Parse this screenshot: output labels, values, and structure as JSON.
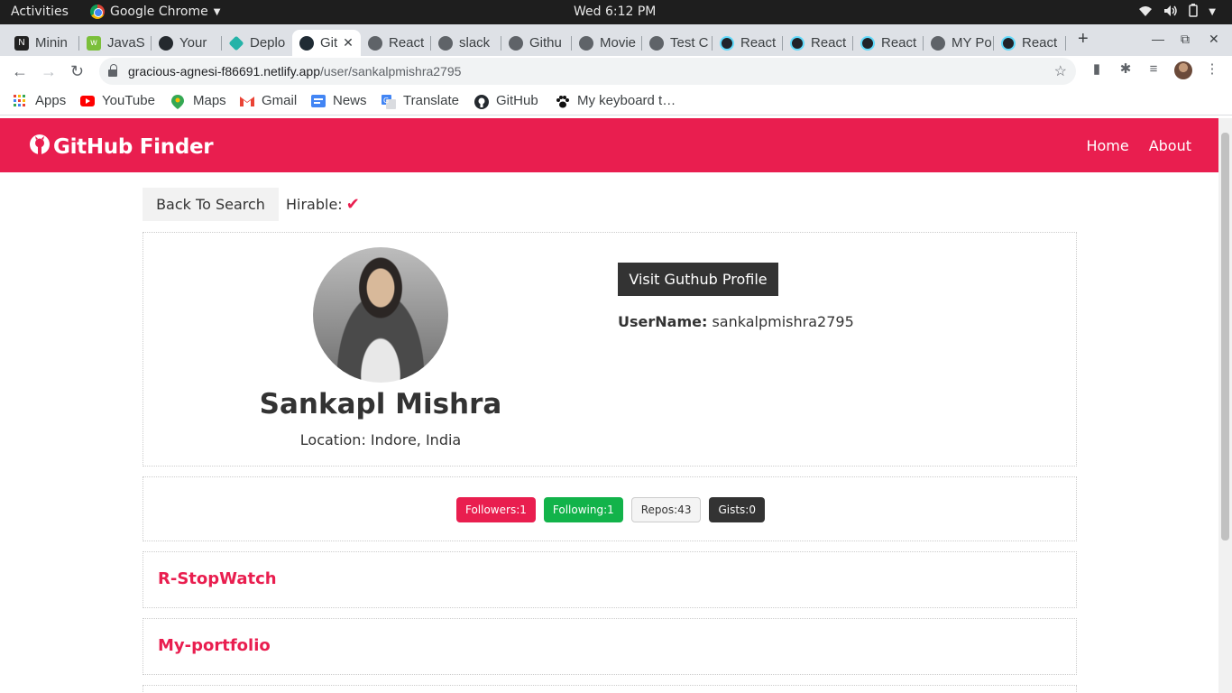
{
  "system": {
    "activities": "Activities",
    "app_name": "Google Chrome",
    "clock": "Wed  6:12 PM"
  },
  "tabs": [
    {
      "title": "Minin",
      "color": "#222"
    },
    {
      "title": "JavaS",
      "color": "#7bbf3a"
    },
    {
      "title": "Your",
      "color": "#24292e"
    },
    {
      "title": "Deplo",
      "color": "#25b3a8"
    },
    {
      "title": "Git",
      "color": "#1f2b34",
      "active": true
    },
    {
      "title": "React",
      "color": "#5f6368"
    },
    {
      "title": "slack",
      "color": "#5f6368"
    },
    {
      "title": "Githu",
      "color": "#5f6368"
    },
    {
      "title": "Movie",
      "color": "#5f6368"
    },
    {
      "title": "Test C",
      "color": "#5f6368"
    },
    {
      "title": "React",
      "color": "#20232a"
    },
    {
      "title": "React",
      "color": "#20232a"
    },
    {
      "title": "React",
      "color": "#20232a"
    },
    {
      "title": "MY Po",
      "color": "#5f6368"
    },
    {
      "title": "React",
      "color": "#20232a"
    }
  ],
  "address": {
    "host": "gracious-agnesi-f86691.netlify.app",
    "path": "/user/sankalpmishra2795"
  },
  "bookmarks": [
    {
      "label": "Apps",
      "icon": "apps-grid-icon"
    },
    {
      "label": "YouTube",
      "icon": "youtube-icon"
    },
    {
      "label": "Maps",
      "icon": "maps-icon"
    },
    {
      "label": "Gmail",
      "icon": "gmail-icon"
    },
    {
      "label": "News",
      "icon": "news-icon"
    },
    {
      "label": "Translate",
      "icon": "translate-icon"
    },
    {
      "label": "GitHub",
      "icon": "github-icon"
    },
    {
      "label": "My keyboard t…",
      "icon": "paw-icon"
    }
  ],
  "navbar": {
    "brand": "GitHub Finder",
    "links": [
      "Home",
      "About"
    ],
    "color": "#e91e4f"
  },
  "actions": {
    "back": "Back To Search",
    "hirable_label": "Hirable:"
  },
  "profile": {
    "name": "Sankapl Mishra",
    "location": "Location: Indore, India",
    "visit_button": "Visit Guthub Profile",
    "username_label": "UserName:",
    "username_value": "sankalpmishra2795"
  },
  "stats": {
    "followers": "Followers:1",
    "following": "Following:1",
    "repos": "Repos:43",
    "gists": "Gists:0"
  },
  "repos": [
    "R-StopWatch",
    "My-portfolio"
  ]
}
